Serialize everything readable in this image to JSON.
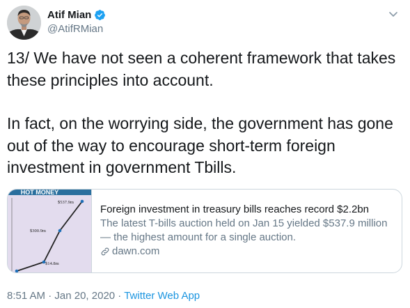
{
  "author": {
    "name": "Atif Mian",
    "handle": "@AtifRMian"
  },
  "tweet": {
    "paragraph_1": "13/ We have not seen a coherent framework that takes these principles into account.",
    "paragraph_2": "In fact, on the worrying side, the government has gone out of the way to encourage short-term foreign investment in government Tbills."
  },
  "card": {
    "thumbnail": {
      "banner": "HOT MONEY",
      "points": [
        {
          "label": "$537.9m"
        },
        {
          "label": "$300.9m"
        },
        {
          "label": "$14.8m"
        }
      ]
    },
    "title": "Foreign investment in treasury bills reaches record $2.2bn",
    "description": "The latest T-bills auction held on Jan 15 yielded $537.9 million — the highest amount for a single auction.",
    "domain": "dawn.com"
  },
  "meta": {
    "time": "8:51 AM",
    "separator": " · ",
    "date": "Jan 20, 2020",
    "source": "Twitter Web App"
  },
  "colors": {
    "text": "#14171a",
    "secondary": "#657786",
    "accent": "#1b95e0",
    "verified": "#1da1f2",
    "card_border": "#ccd6dd"
  },
  "icons": {
    "verified": "verified-badge-icon",
    "caret": "chevron-down-icon",
    "link": "link-icon"
  }
}
